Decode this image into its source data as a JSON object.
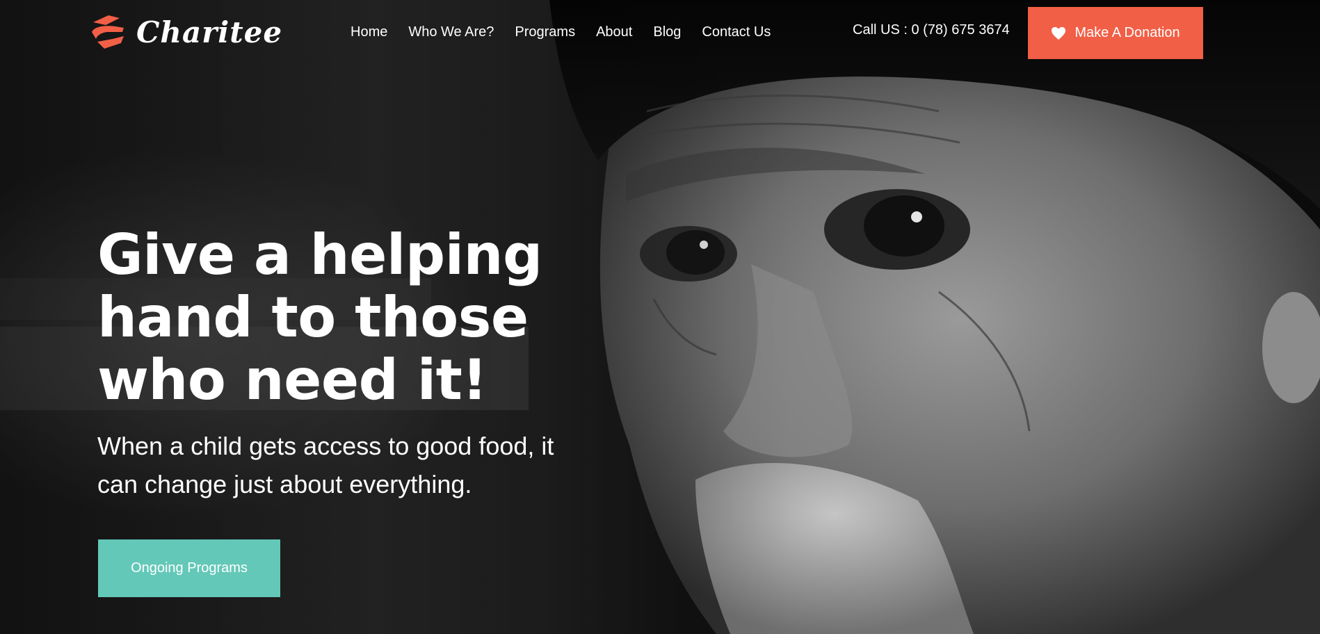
{
  "brand": {
    "name": "Charitee",
    "accent_color": "#f15f46",
    "secondary_color": "#63c8b8",
    "logo_icon": "hand-heart-logo-icon"
  },
  "nav": {
    "items": [
      {
        "label": "Home"
      },
      {
        "label": "Who We Are?"
      },
      {
        "label": "Programs"
      },
      {
        "label": "About"
      },
      {
        "label": "Blog"
      },
      {
        "label": "Contact Us"
      }
    ]
  },
  "header": {
    "call_text": "Call US : 0 (78) 675 3674",
    "donate_label": "Make A Donation",
    "donate_icon": "heart-icon"
  },
  "hero": {
    "headline": "Give a helping hand to those who need it!",
    "subtext": "When a child gets access to good food, it can change just about everything.",
    "cta_label": "Ongoing Programs",
    "background_image": "black-and-white close-up portrait of an elderly man"
  }
}
